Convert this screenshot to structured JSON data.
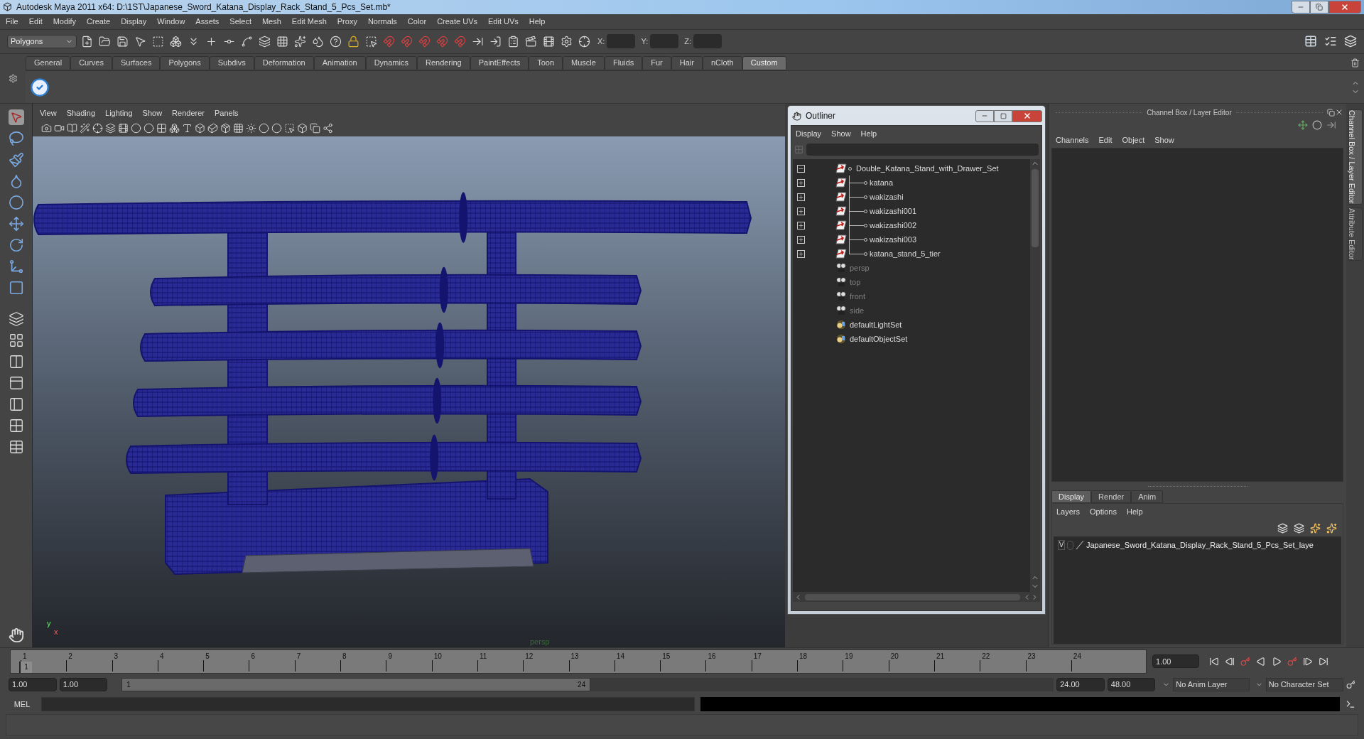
{
  "window": {
    "title": "Autodesk Maya 2011 x64: D:\\1ST\\Japanese_Sword_Katana_Display_Rack_Stand_5_Pcs_Set.mb*"
  },
  "menu_bar": [
    "File",
    "Edit",
    "Modify",
    "Create",
    "Display",
    "Window",
    "Assets",
    "Select",
    "Mesh",
    "Edit Mesh",
    "Proxy",
    "Normals",
    "Color",
    "Create UVs",
    "Edit UVs",
    "Help"
  ],
  "status_line": {
    "mode": "Polygons",
    "coord_fields": [
      {
        "label": "X:"
      },
      {
        "label": "Y:"
      },
      {
        "label": "Z:"
      }
    ]
  },
  "shelf_tabs": [
    {
      "label": "General",
      "selected": false
    },
    {
      "label": "Curves",
      "selected": false
    },
    {
      "label": "Surfaces",
      "selected": false
    },
    {
      "label": "Polygons",
      "selected": false
    },
    {
      "label": "Subdivs",
      "selected": false
    },
    {
      "label": "Deformation",
      "selected": false
    },
    {
      "label": "Animation",
      "selected": false
    },
    {
      "label": "Dynamics",
      "selected": false
    },
    {
      "label": "Rendering",
      "selected": false
    },
    {
      "label": "PaintEffects",
      "selected": false
    },
    {
      "label": "Toon",
      "selected": false
    },
    {
      "label": "Muscle",
      "selected": false
    },
    {
      "label": "Fluids",
      "selected": false
    },
    {
      "label": "Fur",
      "selected": false
    },
    {
      "label": "Hair",
      "selected": false
    },
    {
      "label": "nCloth",
      "selected": false
    },
    {
      "label": "Custom",
      "selected": true
    }
  ],
  "viewport": {
    "menu": [
      "View",
      "Shading",
      "Lighting",
      "Show",
      "Renderer",
      "Panels"
    ],
    "axis_labels": [
      "y",
      "x"
    ],
    "camera_label": "persp"
  },
  "outliner": {
    "title": "Outliner",
    "menu": [
      "Display",
      "Show",
      "Help"
    ],
    "items": [
      {
        "label": "Double_Katana_Stand_with_Drawer_Set",
        "kind": "transform",
        "expanded": true,
        "children": [
          {
            "label": "katana",
            "kind": "transform",
            "expanded": false
          },
          {
            "label": "wakizashi",
            "kind": "transform",
            "expanded": false
          },
          {
            "label": "wakizashi001",
            "kind": "transform",
            "expanded": false
          },
          {
            "label": "wakizashi002",
            "kind": "transform",
            "expanded": false
          },
          {
            "label": "wakizashi003",
            "kind": "transform",
            "expanded": false
          },
          {
            "label": "katana_stand_5_tier",
            "kind": "transform",
            "expanded": false
          }
        ]
      },
      {
        "label": "persp",
        "kind": "camera",
        "hidden": true
      },
      {
        "label": "top",
        "kind": "camera",
        "hidden": true
      },
      {
        "label": "front",
        "kind": "camera",
        "hidden": true
      },
      {
        "label": "side",
        "kind": "camera",
        "hidden": true
      },
      {
        "label": "defaultLightSet",
        "kind": "set",
        "hidden": false
      },
      {
        "label": "defaultObjectSet",
        "kind": "set",
        "hidden": false
      }
    ]
  },
  "channel_box": {
    "title": "Channel Box / Layer Editor",
    "menu": [
      "Channels",
      "Edit",
      "Object",
      "Show"
    ],
    "layer_tabs": [
      {
        "label": "Display",
        "selected": true
      },
      {
        "label": "Render",
        "selected": false
      },
      {
        "label": "Anim",
        "selected": false
      }
    ],
    "layer_menu": [
      "Layers",
      "Options",
      "Help"
    ],
    "layers": [
      {
        "visibility": "V",
        "name": "Japanese_Sword_Katana_Display_Rack_Stand_5_Pcs_Set_laye"
      }
    ]
  },
  "side_tabs": [
    {
      "label": "Channel Box / Layer Editor",
      "selected": true
    },
    {
      "label": "Attribute Editor",
      "selected": false
    }
  ],
  "timeline": {
    "ticks": [
      "1",
      "2",
      "3",
      "4",
      "5",
      "6",
      "7",
      "8",
      "9",
      "10",
      "11",
      "12",
      "13",
      "14",
      "15",
      "16",
      "17",
      "18",
      "19",
      "20",
      "21",
      "22",
      "23",
      "24"
    ],
    "current_frame": "1",
    "level": 0,
    "frame_field": "1.00"
  },
  "range": {
    "start": "1.00",
    "playback_start": "1.00",
    "slider_start": "1",
    "slider_end": "24",
    "level": 0.5,
    "playback_end": "24.00",
    "end": "48.00",
    "anim_layer": "No Anim Layer",
    "character_set": "No Character Set"
  },
  "command_line": {
    "label": "MEL"
  }
}
